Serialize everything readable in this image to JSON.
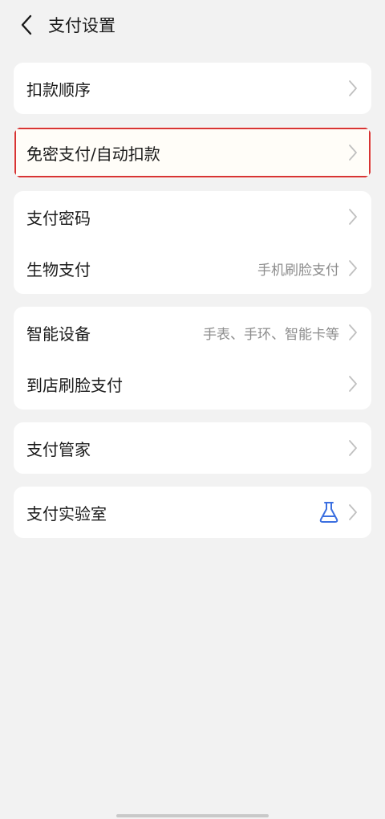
{
  "header": {
    "title": "支付设置",
    "back_icon": "back-arrow-icon"
  },
  "groups": [
    {
      "items": [
        {
          "label": "扣款顺序"
        }
      ]
    },
    {
      "items": [
        {
          "label": "免密支付/自动扣款"
        }
      ]
    },
    {
      "items": [
        {
          "label": "支付密码"
        },
        {
          "label": "生物支付",
          "value": "手机刷脸支付"
        }
      ]
    },
    {
      "items": [
        {
          "label": "智能设备",
          "value": "手表、手环、智能卡等"
        },
        {
          "label": "到店刷脸支付"
        }
      ]
    },
    {
      "items": [
        {
          "label": "支付管家"
        }
      ]
    },
    {
      "items": [
        {
          "label": "支付实验室",
          "icon": "flask-icon"
        }
      ]
    }
  ],
  "colors": {
    "highlight_border": "#d73434",
    "flask": "#3b6fe0",
    "chevron": "#c0c0c0"
  }
}
